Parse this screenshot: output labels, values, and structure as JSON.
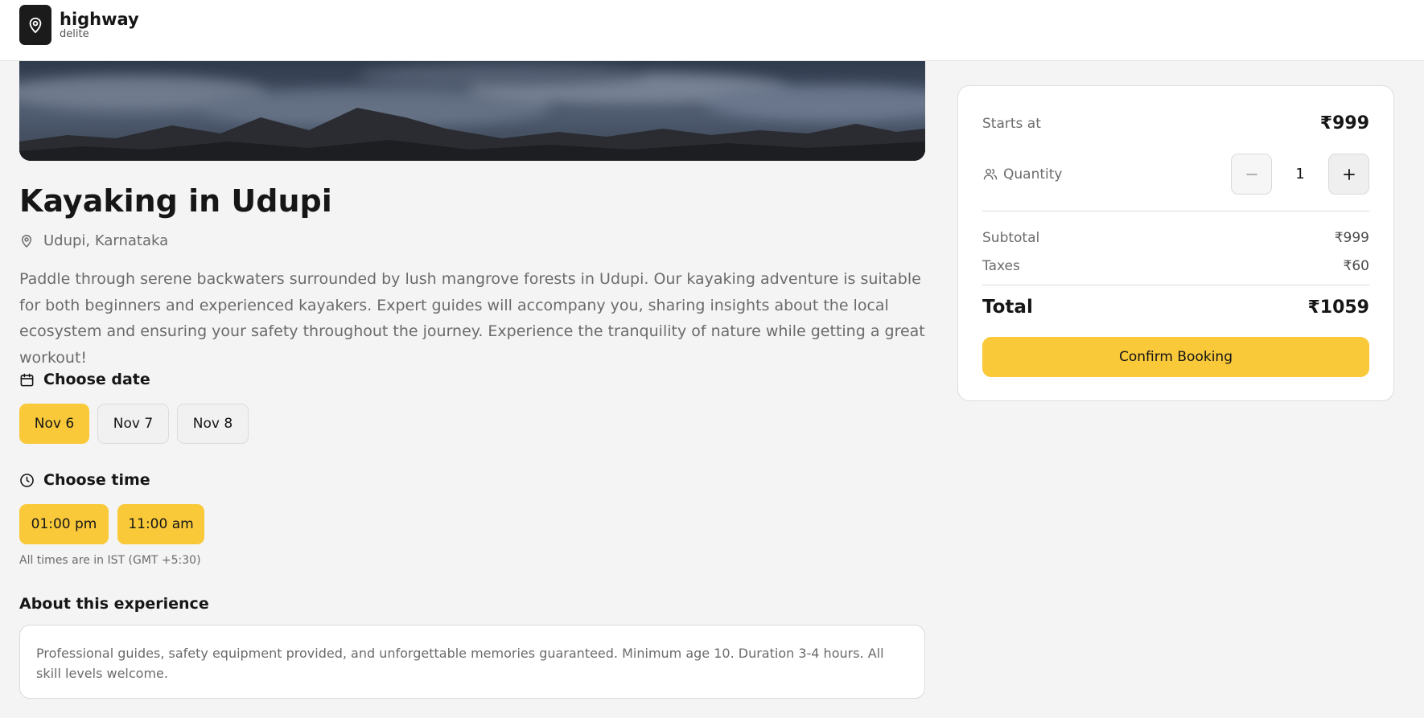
{
  "brand": {
    "name": "highway",
    "sub": "delite"
  },
  "experience": {
    "title": "Kayaking in Udupi",
    "location": "Udupi, Karnataka",
    "description": "Paddle through serene backwaters surrounded by lush mangrove forests in Udupi. Our kayaking adventure is suitable for both beginners and experienced kayakers. Expert guides will accompany you, sharing insights about the local ecosystem and ensuring your safety throughout the journey. Experience the tranquility of nature while getting a great workout!"
  },
  "date": {
    "heading": "Choose date",
    "options": [
      {
        "label": "Nov 6",
        "selected": true
      },
      {
        "label": "Nov 7",
        "selected": false
      },
      {
        "label": "Nov 8",
        "selected": false
      }
    ]
  },
  "time": {
    "heading": "Choose time",
    "options": [
      {
        "label": "01:00 pm",
        "selected": true
      },
      {
        "label": "11:00 am",
        "selected": true
      }
    ],
    "note": "All times are in IST (GMT +5:30)"
  },
  "about": {
    "heading": "About this experience",
    "text": "Professional guides, safety equipment provided, and unforgettable memories guaranteed. Minimum age 10. Duration 3-4 hours. All skill levels welcome."
  },
  "booking": {
    "starts_at_label": "Starts at",
    "starts_at_price": "₹999",
    "quantity_label": "Quantity",
    "quantity": "1",
    "subtotal_label": "Subtotal",
    "subtotal": "₹999",
    "taxes_label": "Taxes",
    "taxes": "₹60",
    "total_label": "Total",
    "total": "₹1059",
    "confirm_label": "Confirm Booking"
  },
  "colors": {
    "accent": "#f9c93a",
    "background": "#f4f4f4",
    "text": "#161616",
    "muted": "#6b6b6b"
  },
  "icons": [
    "map-pin-icon",
    "calendar-icon",
    "clock-icon",
    "users-icon",
    "minus-icon",
    "plus-icon"
  ]
}
